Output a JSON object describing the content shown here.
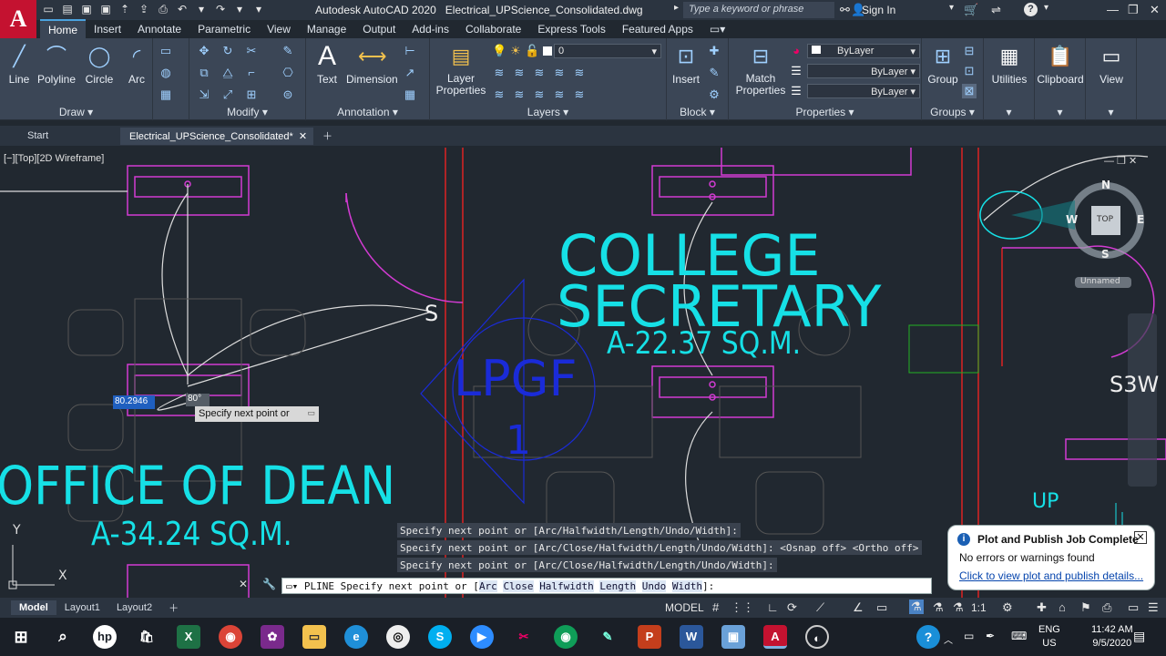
{
  "app": {
    "title": "Autodesk AutoCAD 2020",
    "filename": "Electrical_UPScience_Consolidated.dwg",
    "logo_letter": "A",
    "search_placeholder": "Type a keyword or phrase",
    "sign_in": "Sign In"
  },
  "ribbon_tabs": [
    "Home",
    "Insert",
    "Annotate",
    "Parametric",
    "View",
    "Manage",
    "Output",
    "Add-ins",
    "Collaborate",
    "Express Tools",
    "Featured Apps"
  ],
  "draw": {
    "title": "Draw",
    "line": "Line",
    "polyline": "Polyline",
    "circle": "Circle",
    "arc": "Arc"
  },
  "modify": {
    "title": "Modify"
  },
  "annotation": {
    "title": "Annotation",
    "text": "Text",
    "dimension": "Dimension"
  },
  "layers": {
    "title": "Layers",
    "layer_properties_1": "Layer",
    "layer_properties_2": "Properties",
    "current_layer": "0"
  },
  "block": {
    "title": "Block",
    "insert": "Insert"
  },
  "properties": {
    "title": "Properties",
    "match_1": "Match",
    "match_2": "Properties",
    "color": "ByLayer",
    "linetype": "ByLayer",
    "lineweight": "ByLayer"
  },
  "groups": {
    "title": "Groups",
    "group": "Group"
  },
  "utilities": {
    "label": "Utilities"
  },
  "clipboard": {
    "label": "Clipboard"
  },
  "view": {
    "label": "View"
  },
  "doc_tabs": {
    "start": "Start",
    "active": "Electrical_UPScience_Consolidated*"
  },
  "viewport": {
    "label": "[−][Top][2D Wireframe]",
    "college": "COLLEGE",
    "secretary": "SECRETARY",
    "area_secretary": "A-22.37 SQ.M.",
    "office": "OFFICE OF DEAN",
    "area_office": "A-34.24 SQ.M.",
    "lpgf": "LPGF",
    "lpgf_num": "1",
    "s_mark": "S",
    "s3w": "S3W",
    "up": "UP",
    "axis_y": "Y",
    "axis_x": "X"
  },
  "viewcube": {
    "n": "N",
    "s": "S",
    "e": "E",
    "w": "W",
    "top": "TOP",
    "ucs": "Unnamed"
  },
  "dynamic_input": {
    "value": "80.2946",
    "angle": "80°",
    "prompt": "Specify next point or"
  },
  "command_history": [
    "Specify next point or [Arc/Halfwidth/Length/Undo/Width]:",
    "Specify next point or [Arc/Close/Halfwidth/Length/Undo/Width]:  <Osnap off>  <Ortho off>",
    "Specify next point or [Arc/Close/Halfwidth/Length/Undo/Width]:"
  ],
  "command_line": {
    "prefix": "PLINE Specify next point or [",
    "opt_arc": "Arc",
    "opt_close": "Close",
    "opt_half": "Halfwidth",
    "opt_length": "Length",
    "opt_undo": "Undo",
    "opt_width": "Width",
    "suffix": "]:"
  },
  "notification": {
    "title": "Plot and Publish Job Complete",
    "body": "No errors or warnings found",
    "link": "Click to view plot and publish details..."
  },
  "layout_tabs": [
    "Model",
    "Layout1",
    "Layout2"
  ],
  "status": {
    "model": "MODEL",
    "scale": "1:1"
  },
  "taskbar": {
    "lang_1": "ENG",
    "lang_2": "US",
    "time": "11:42 AM",
    "date": "9/5/2020"
  },
  "colors": {
    "cyan": "#16e0e6",
    "magenta": "#d23bd2",
    "red": "#d22",
    "blue": "#1a2bd8",
    "green": "#23b223"
  }
}
